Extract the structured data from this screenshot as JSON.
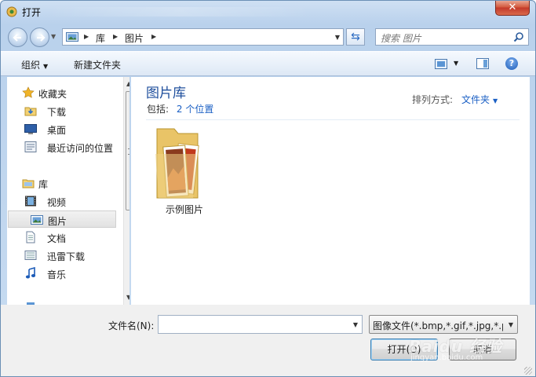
{
  "window": {
    "title": "打开",
    "close_label": "✕"
  },
  "nav": {
    "address_segments": [
      "库",
      "图片"
    ],
    "search_placeholder": "搜索 图片"
  },
  "toolbar": {
    "organize_label": "组织",
    "new_folder_label": "新建文件夹",
    "help_label": "?"
  },
  "sidebar": {
    "items": [
      {
        "label": "收藏夹",
        "icon": "star-icon",
        "group": true
      },
      {
        "label": "下载",
        "icon": "download-folder-icon"
      },
      {
        "label": "桌面",
        "icon": "desktop-icon"
      },
      {
        "label": "最近访问的位置",
        "icon": "recent-places-icon"
      },
      {
        "label": "库",
        "icon": "library-icon",
        "group": true
      },
      {
        "label": "视频",
        "icon": "video-icon"
      },
      {
        "label": "图片",
        "icon": "pictures-icon",
        "selected": true
      },
      {
        "label": "文档",
        "icon": "documents-icon"
      },
      {
        "label": "迅雷下载",
        "icon": "thunder-download-icon"
      },
      {
        "label": "音乐",
        "icon": "music-icon"
      }
    ]
  },
  "content": {
    "library_title": "图片库",
    "includes_label": "包括:",
    "includes_link": "2 个位置",
    "arrange_label": "排列方式:",
    "arrange_value": "文件夹",
    "items": [
      {
        "label": "示例图片",
        "icon": "pictures-folder-icon"
      }
    ]
  },
  "footer": {
    "filename_label": "文件名(N):",
    "filename_value": "",
    "filter_value": "图像文件(*.bmp,*.gif,*.jpg,*.pn",
    "open_label": "打开(O)",
    "cancel_label": "取消",
    "watermark": "Baidu 经验",
    "watermark_sub": "jingyan.baidu.com"
  },
  "colors": {
    "title_blue": "#1e4e9c",
    "link_blue": "#1a5fc4",
    "close_red": "#c3392a"
  }
}
